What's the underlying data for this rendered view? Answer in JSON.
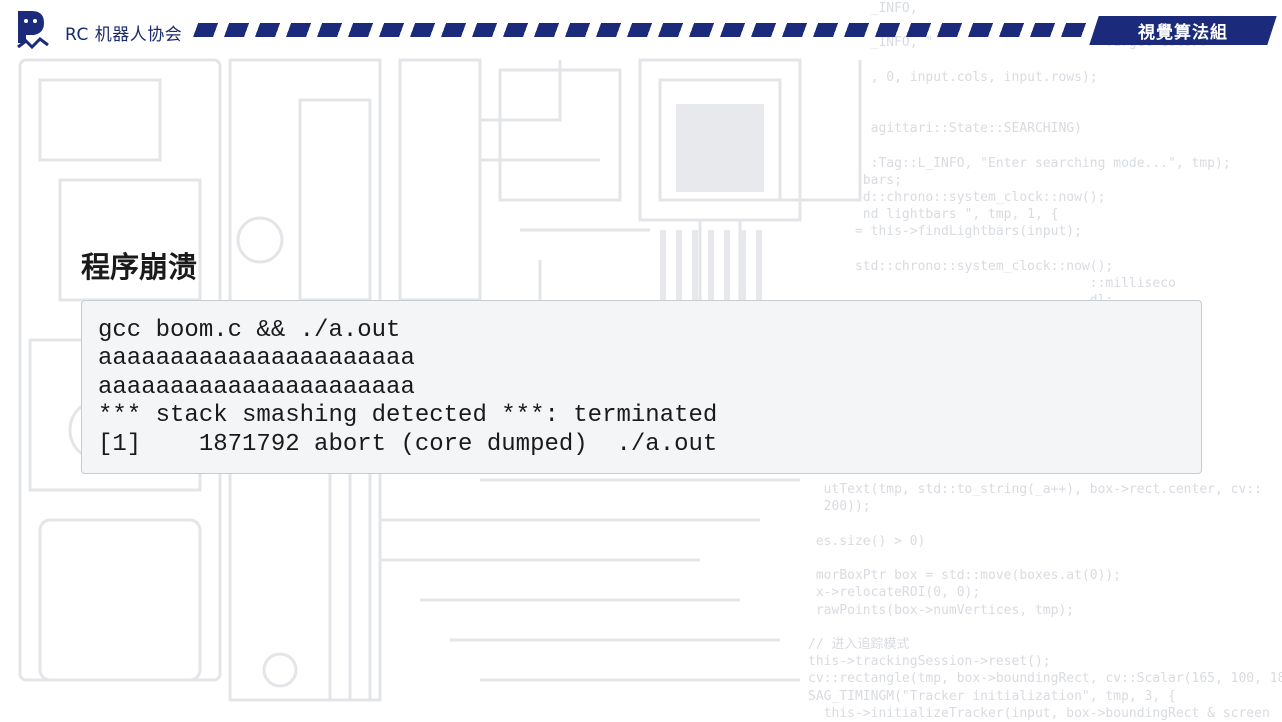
{
  "header": {
    "org_name": "RC 机器人协会",
    "dept_tag": "視覺算法組",
    "logo_icon": "rc-logo-icon",
    "brand_color": "#1b2a7b"
  },
  "slide": {
    "title": "程序崩溃",
    "terminal_lines": [
      "gcc boom.c && ./a.out",
      "aaaaaaaaaaaaaaaaaaaaaa",
      "aaaaaaaaaaaaaaaaaaaaaa",
      "*** stack smashing detected ***: terminated",
      "[1]    1871792 abort (core dumped)  ./a.out"
    ]
  },
  "background_code": [
    "        _INFO,",
    "",
    "        _INFO, \"                      Target color:",
    "",
    "        , 0, input.cols, input.rows);",
    "",
    "",
    "        agittari::State::SEARCHING)",
    "",
    "        :Tag::L_INFO, \"Enter searching mode...\", tmp);",
    "       bars;",
    "       d::chrono::system_clock::now();",
    "       nd lightbars \", tmp, 1, {",
    "      = this->findLightbars(input);",
    "",
    "      std::chrono::system_clock::now();",
    "                                    ::milliseco",
    "                                    dl;",
    "",
    "",
    "",
    "",
    "",
    "",
    "",
    "",
    "",
    "",
    "  utText(tmp, std::to_string(_a++), box->rect.center, cv::",
    "  200));",
    "",
    " es.size() > 0)",
    "",
    " morBoxPtr box = std::move(boxes.at(0));",
    " x->relocateROI(0, 0);",
    " rawPoints(box->numVertices, tmp);",
    "",
    "// 进入追踪模式",
    "this->trackingSession->reset();",
    "cv::rectangle(tmp, box->boundingRect, cv::Scalar(165, 100, 18",
    "SAG_TIMINGM(\"Tracker initialization\", tmp, 3, {",
    "  this->initializeTracker(input, box->boundingRect & screen"
  ]
}
